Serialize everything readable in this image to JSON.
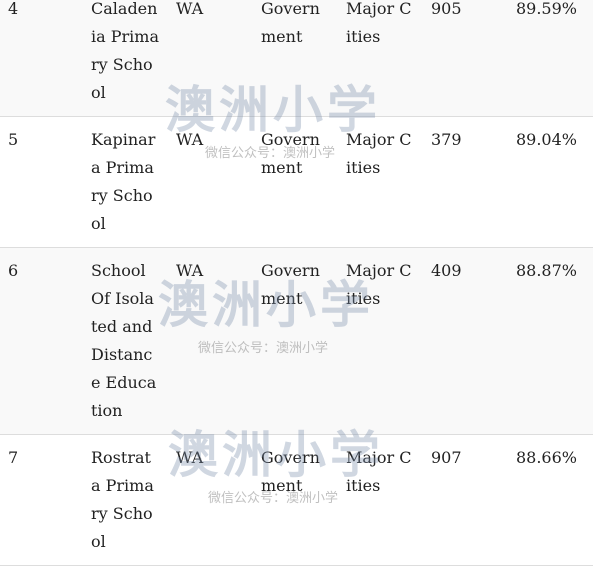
{
  "rows": [
    {
      "rank": "4",
      "name": "Caladenia Primary School",
      "state": "WA",
      "sector": "Government",
      "type": "Major Cities",
      "count": "905",
      "percent": "89.59%"
    },
    {
      "rank": "5",
      "name": "Kapinara Primary School",
      "state": "WA",
      "sector": "Government",
      "type": "Major Cities",
      "count": "379",
      "percent": "89.04%"
    },
    {
      "rank": "6",
      "name": "School Of Isolated and Distance Education",
      "state": "WA",
      "sector": "Government",
      "type": "Major Cities",
      "count": "409",
      "percent": "88.87%"
    },
    {
      "rank": "7",
      "name": "Rostrata Primary School",
      "state": "WA",
      "sector": "Government",
      "type": "Major Cities",
      "count": "907",
      "percent": "88.66%"
    }
  ],
  "watermark": {
    "logo": "澳洲小学",
    "caption": "微信公众号：澳洲小学"
  }
}
